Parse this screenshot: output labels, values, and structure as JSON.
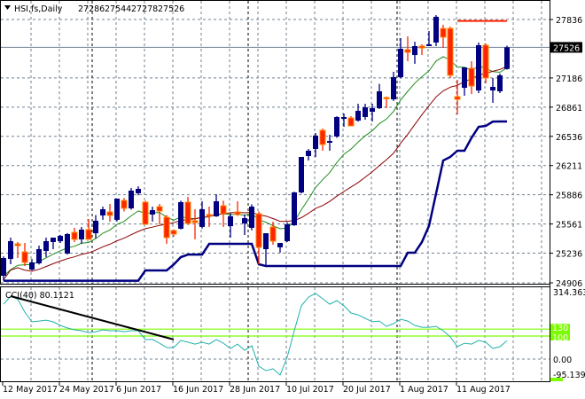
{
  "header": {
    "arrow_icon": "triangle-down-icon",
    "symbol": "HSI,fs,Daily",
    "open": "27286",
    "high": "27544",
    "low": "27278",
    "close": "27526"
  },
  "colors": {
    "bull": "#000080",
    "bear": "#ff2400",
    "ma_fast": "#1e8c1e",
    "ma_slow": "#8b0000",
    "channel": "#000080",
    "cci": "#20b2aa",
    "levels": "#7cfc00",
    "grid": "#708090"
  },
  "chart_data": [
    {
      "type": "candlestick",
      "title": "HSI,fs,Daily",
      "ylim": [
        24906,
        27836
      ],
      "price_ticks": [
        "27836",
        "27186",
        "26861",
        "26536",
        "26211",
        "25886",
        "25561",
        "25236",
        "24906"
      ],
      "price_tick_values": [
        27836,
        27186,
        26861,
        26536,
        26211,
        25886,
        25561,
        25236,
        24906
      ],
      "current_price": "27526",
      "current_price_value": 27526,
      "resistance_line": {
        "value": 27820,
        "from_index": 64,
        "to_index": 71
      },
      "separators": [
        13,
        35,
        56
      ],
      "date_labels": [
        {
          "index": 0,
          "label": "12 May 2017"
        },
        {
          "index": 8,
          "label": "24 May 2017"
        },
        {
          "index": 16,
          "label": "6 Jun 2017"
        },
        {
          "index": 24,
          "label": "16 Jun 2017"
        },
        {
          "index": 32,
          "label": "28 Jun 2017"
        },
        {
          "index": 40,
          "label": "10 Jul 2017"
        },
        {
          "index": 48,
          "label": "20 Jul 2017"
        },
        {
          "index": 56,
          "label": "1 Aug 2017"
        },
        {
          "index": 64,
          "label": "11 Aug 2017"
        }
      ],
      "ohlc": [
        [
          24985,
          25200,
          24930,
          25182
        ],
        [
          25172,
          25409,
          25113,
          25370
        ],
        [
          25340,
          25360,
          25182,
          25320
        ],
        [
          25251,
          25350,
          25093,
          25133
        ],
        [
          25054,
          25172,
          25044,
          25133
        ],
        [
          25123,
          25320,
          25110,
          25281
        ],
        [
          25261,
          25409,
          25192,
          25370
        ],
        [
          25360,
          25400,
          25280,
          25409
        ],
        [
          25370,
          25440,
          25350,
          25429
        ],
        [
          25232,
          25460,
          25220,
          25449
        ],
        [
          25468,
          25518,
          25360,
          25390
        ],
        [
          25390,
          25528,
          25340,
          25498
        ],
        [
          25498,
          25616,
          25390,
          25390
        ],
        [
          25458,
          25660,
          25400,
          25597
        ],
        [
          25656,
          25754,
          25607,
          25725
        ],
        [
          25695,
          25784,
          25587,
          25656
        ],
        [
          25607,
          25843,
          25590,
          25843
        ],
        [
          25823,
          25850,
          25700,
          25735
        ],
        [
          25735,
          25962,
          25720,
          25932
        ],
        [
          25903,
          25980,
          25880,
          25952
        ],
        [
          25804,
          25820,
          25560,
          25557
        ],
        [
          25666,
          25754,
          25587,
          25715
        ],
        [
          25754,
          25784,
          25557,
          25705
        ],
        [
          25636,
          25660,
          25340,
          25409
        ],
        [
          25488,
          25500,
          25420,
          25449
        ],
        [
          25508,
          25820,
          25500,
          25804
        ],
        [
          25804,
          25863,
          25550,
          25567
        ],
        [
          25597,
          25725,
          25390,
          25577
        ],
        [
          25528,
          25814,
          25510,
          25725
        ],
        [
          25666,
          25754,
          25528,
          25646
        ],
        [
          25646,
          25893,
          25640,
          25814
        ],
        [
          25764,
          25820,
          25528,
          25675
        ],
        [
          25537,
          25680,
          25409,
          25646
        ],
        [
          25695,
          25814,
          25650,
          25666
        ],
        [
          25567,
          25666,
          25439,
          25626
        ],
        [
          25518,
          25780,
          25490,
          25754
        ],
        [
          25675,
          25700,
          25113,
          25301
        ],
        [
          25281,
          25458,
          25093,
          25458
        ],
        [
          25528,
          25587,
          25330,
          25370
        ],
        [
          25301,
          25350,
          25241,
          25350
        ],
        [
          25370,
          25580,
          25360,
          25557
        ],
        [
          25547,
          25920,
          25540,
          25912
        ],
        [
          25912,
          26300,
          25900,
          26307
        ],
        [
          26317,
          26396,
          26267,
          26376
        ],
        [
          26396,
          26573,
          26307,
          26544
        ],
        [
          26603,
          26623,
          26376,
          26445
        ],
        [
          26465,
          26554,
          26376,
          26484
        ],
        [
          26534,
          26760,
          26520,
          26751
        ],
        [
          26731,
          26790,
          26642,
          26751
        ],
        [
          26741,
          26760,
          26652,
          26652
        ],
        [
          26711,
          26899,
          26700,
          26820
        ],
        [
          26751,
          26899,
          26721,
          26859
        ],
        [
          26810,
          26899,
          26702,
          26849
        ],
        [
          26849,
          27120,
          26840,
          27037
        ],
        [
          26968,
          26978,
          26849,
          26958
        ],
        [
          26948,
          27254,
          26930,
          27195
        ],
        [
          27195,
          27629,
          27180,
          27510
        ],
        [
          27501,
          27649,
          27372,
          27471
        ],
        [
          27441,
          27589,
          27343,
          27540
        ],
        [
          27540,
          27560,
          27441,
          27520
        ],
        [
          27540,
          27708,
          27540,
          27560
        ],
        [
          27580,
          27885,
          27540,
          27866
        ],
        [
          27737,
          27777,
          27520,
          27639
        ],
        [
          27737,
          27757,
          27185,
          27215
        ],
        [
          26978,
          27165,
          26780,
          26948
        ],
        [
          27076,
          27303,
          26988,
          27303
        ],
        [
          27293,
          27372,
          27007,
          27096
        ],
        [
          27047,
          27580,
          27017,
          27550
        ],
        [
          27550,
          27570,
          27126,
          27185
        ],
        [
          27047,
          27185,
          26909,
          27086
        ],
        [
          27037,
          27234,
          27017,
          27215
        ],
        [
          27286,
          27544,
          27278,
          27526
        ]
      ]
    },
    {
      "type": "line",
      "title": "CCI(40) 80.1121",
      "ylim": [
        -95.1391,
        314.3633
      ],
      "tick_labels": [
        "314.3633",
        "0.00",
        "-95.1391"
      ],
      "tick_values": [
        314.3633,
        0,
        -95.1391
      ],
      "levels": [
        {
          "value": 130,
          "label": "130"
        },
        {
          "value": 100,
          "label": "100"
        }
      ],
      "trendline": {
        "from": [
          1,
          273
        ],
        "to": [
          24,
          85
        ]
      },
      "values": [
        238,
        273,
        260,
        204,
        162,
        165,
        169,
        162,
        146,
        135,
        127,
        123,
        115,
        119,
        127,
        123,
        123,
        119,
        123,
        123,
        85,
        85,
        69,
        50,
        50,
        81,
        73,
        65,
        73,
        65,
        85,
        69,
        46,
        65,
        38,
        58,
        -31,
        -50,
        -42,
        -69,
        8,
        123,
        231,
        269,
        285,
        262,
        238,
        254,
        231,
        200,
        192,
        177,
        162,
        165,
        142,
        154,
        173,
        165,
        146,
        138,
        138,
        142,
        123,
        96,
        54,
        69,
        65,
        81,
        73,
        46,
        54,
        80.1121
      ]
    }
  ]
}
